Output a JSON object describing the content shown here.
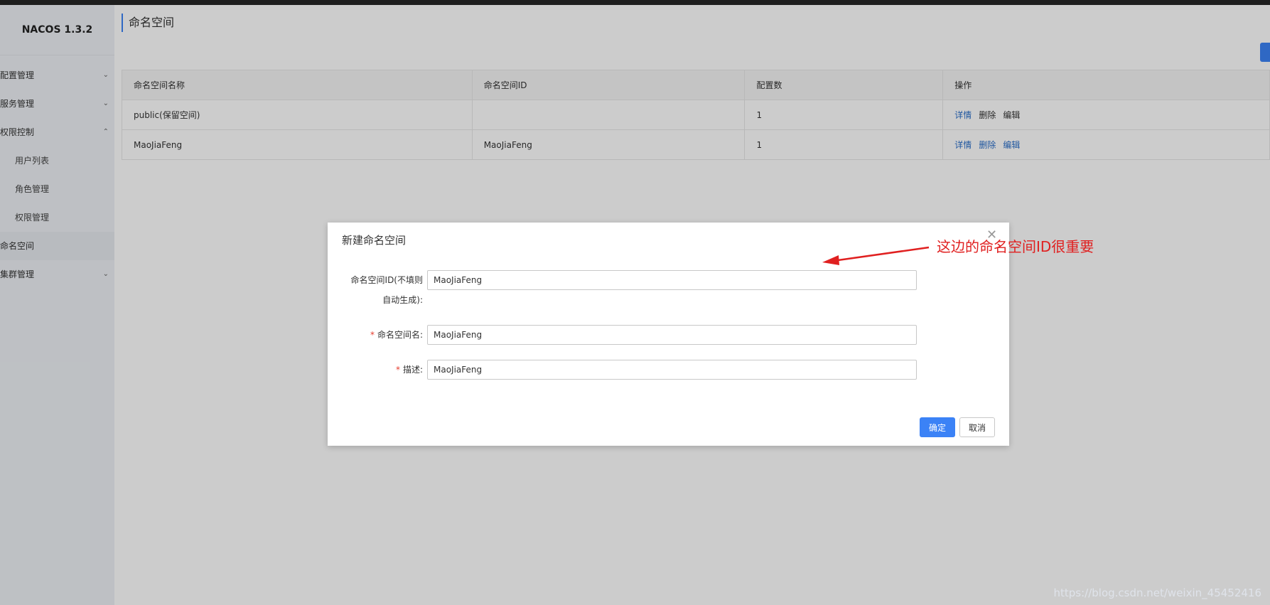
{
  "app": {
    "brand": "NACOS 1.3.2"
  },
  "sidebar": {
    "items": [
      {
        "label": "配置管理",
        "chevron": "chevron-down"
      },
      {
        "label": "服务管理",
        "chevron": "chevron-down"
      },
      {
        "label": "权限控制",
        "chevron": "chevron-up"
      },
      {
        "label": "用户列表"
      },
      {
        "label": "角色管理"
      },
      {
        "label": "权限管理"
      },
      {
        "label": "命名空间",
        "active": true
      },
      {
        "label": "集群管理",
        "chevron": "chevron-down"
      }
    ]
  },
  "main": {
    "title": "命名空间",
    "table": {
      "headers": [
        "命名空间名称",
        "命名空间ID",
        "配置数",
        "操作"
      ],
      "rows": [
        {
          "name": "public(保留空间)",
          "id": "",
          "count": "1",
          "actions": [
            "详情",
            "删除",
            "编辑"
          ]
        },
        {
          "name": "MaoJiaFeng",
          "id": "MaoJiaFeng",
          "count": "1",
          "actions": [
            "详情",
            "删除",
            "编辑"
          ]
        }
      ]
    }
  },
  "dialog": {
    "title": "新建命名空间",
    "close_icon": "close-icon",
    "fields": {
      "id_label_line1": "命名空间ID(不填则",
      "id_label_line2": "自动生成):",
      "id_value": "MaoJiaFeng",
      "name_required_mark": "*",
      "name_label": "命名空间名:",
      "name_value": "MaoJiaFeng",
      "desc_required_mark": "*",
      "desc_label": "描述:",
      "desc_value": "MaoJiaFeng"
    },
    "ok_label": "确定",
    "cancel_label": "取消"
  },
  "annotation": {
    "text": "这边的命名空间ID很重要",
    "color": "#e02020"
  },
  "watermark": "https://blog.csdn.net/weixin_45452416",
  "colors": {
    "accent": "#3b82f6",
    "link": "#2a6ec9",
    "required": "#e63c2e"
  }
}
